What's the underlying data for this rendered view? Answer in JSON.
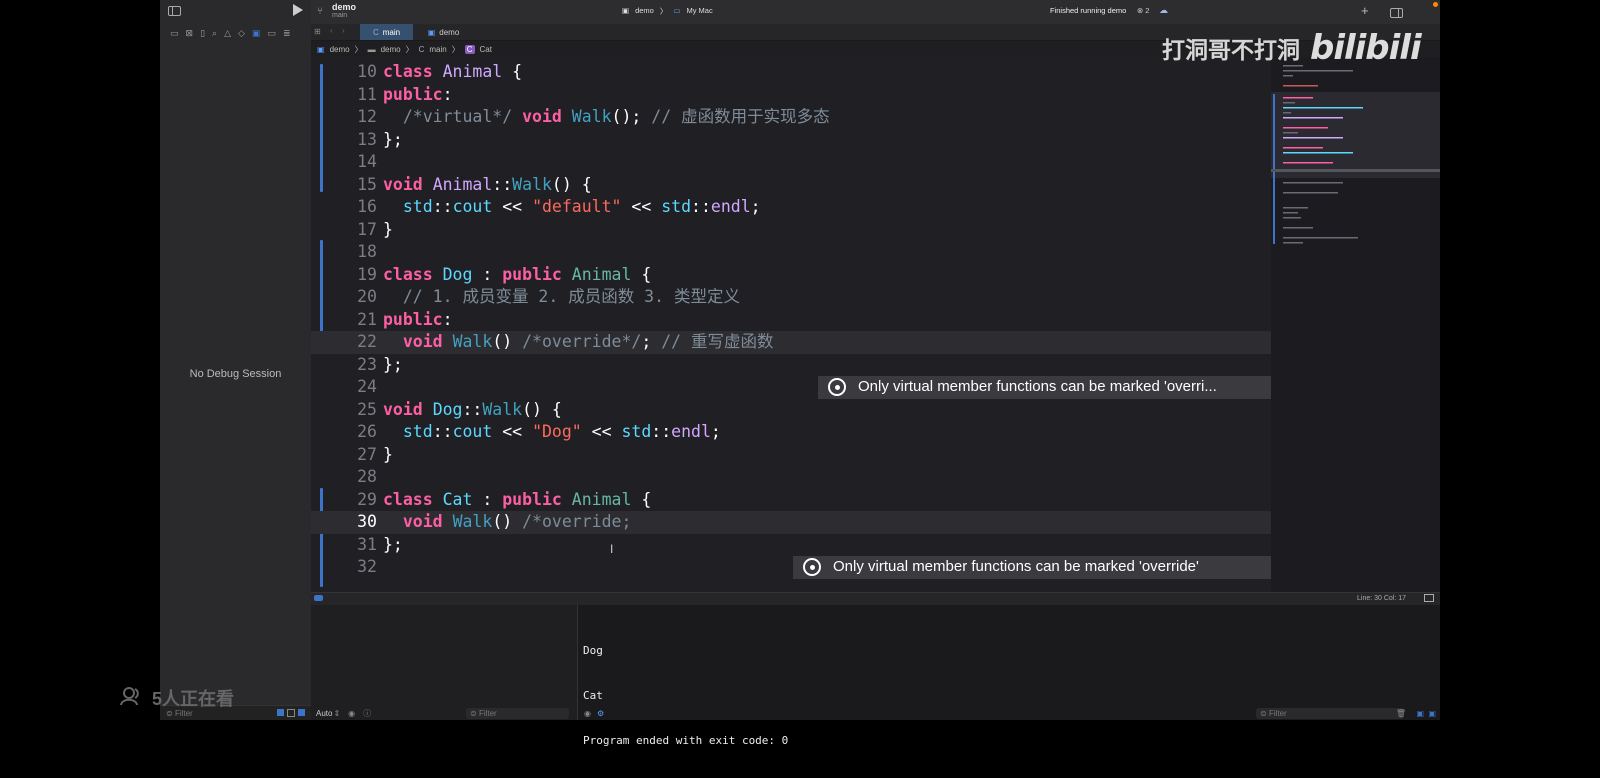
{
  "toolbar": {
    "project": "demo",
    "branch": "main",
    "scheme": "demo",
    "destination": "My Mac",
    "status": "Finished running demo",
    "issue_count": "2"
  },
  "tabs": [
    "main",
    "demo"
  ],
  "breadcrumb": [
    "demo",
    "demo",
    "main",
    "Cat"
  ],
  "navigator": {
    "empty_text": "No Debug Session",
    "filter_placeholder": "Filter"
  },
  "editor": {
    "lines": [
      {
        "n": "10"
      },
      {
        "n": "11"
      },
      {
        "n": "12"
      },
      {
        "n": "13"
      },
      {
        "n": "14"
      },
      {
        "n": "15"
      },
      {
        "n": "16"
      },
      {
        "n": "17"
      },
      {
        "n": "18"
      },
      {
        "n": "19"
      },
      {
        "n": "20"
      },
      {
        "n": "21"
      },
      {
        "n": "22"
      },
      {
        "n": "23"
      },
      {
        "n": "24"
      },
      {
        "n": "25"
      },
      {
        "n": "26"
      },
      {
        "n": "27"
      },
      {
        "n": "28"
      },
      {
        "n": "29"
      },
      {
        "n": "30"
      },
      {
        "n": "31"
      },
      {
        "n": "32"
      }
    ],
    "code": {
      "l10": [
        "class",
        "Animal",
        "{"
      ],
      "l11": [
        "public",
        ":"
      ],
      "l12": [
        "/*virtual*/",
        "void",
        "Walk",
        "();",
        "// 虚函数用于实现多态"
      ],
      "l13": [
        "};"
      ],
      "l15": [
        "void",
        "Animal",
        "::",
        "Walk",
        "() {"
      ],
      "l16": [
        "std",
        "::",
        "cout",
        "<<",
        "\"default\"",
        "<<",
        "std",
        "::",
        "endl",
        ";"
      ],
      "l17": [
        "}"
      ],
      "l19": [
        "class",
        "Dog",
        ":",
        "public",
        "Animal",
        "{"
      ],
      "l20": [
        "// 1. 成员变量 2. 成员函数 3. 类型定义"
      ],
      "l21": [
        "public",
        ":"
      ],
      "l22": [
        "void",
        "Walk",
        "()",
        "/*override*/",
        ";",
        "// 重写虚函数"
      ],
      "l23": [
        "};"
      ],
      "l25": [
        "void",
        "Dog",
        "::",
        "Walk",
        "() {"
      ],
      "l26": [
        "std",
        "::",
        "cout",
        "<<",
        "\"Dog\"",
        "<<",
        "std",
        "::",
        "endl",
        ";"
      ],
      "l27": [
        "}"
      ],
      "l29": [
        "class",
        "Cat",
        ":",
        "public",
        "Animal",
        "{"
      ],
      "l30": [
        "void",
        "Walk",
        "()",
        "/*override;"
      ],
      "l31": [
        "};"
      ]
    },
    "errors": {
      "line22": "Only virtual member functions can be marked 'overri...",
      "line30": "Only virtual member functions can be marked 'override'"
    },
    "cursor_position": "Line: 30  Col: 17"
  },
  "variables": {
    "scope": "Auto",
    "filter_placeholder": "Filter"
  },
  "console": {
    "output": [
      "Dog",
      "Cat",
      "Program ended with exit code: 0"
    ],
    "filter_placeholder": "Filter"
  },
  "watermark": {
    "channel": "打洞哥不打洞",
    "logo": "bilibili",
    "viewers": "5人正在看"
  },
  "colors": {
    "keyword": "#fc5fa3",
    "type": "#5dd8ff",
    "string": "#fc6a5d",
    "comment": "#7f8c98",
    "accent": "#3b74c9"
  }
}
